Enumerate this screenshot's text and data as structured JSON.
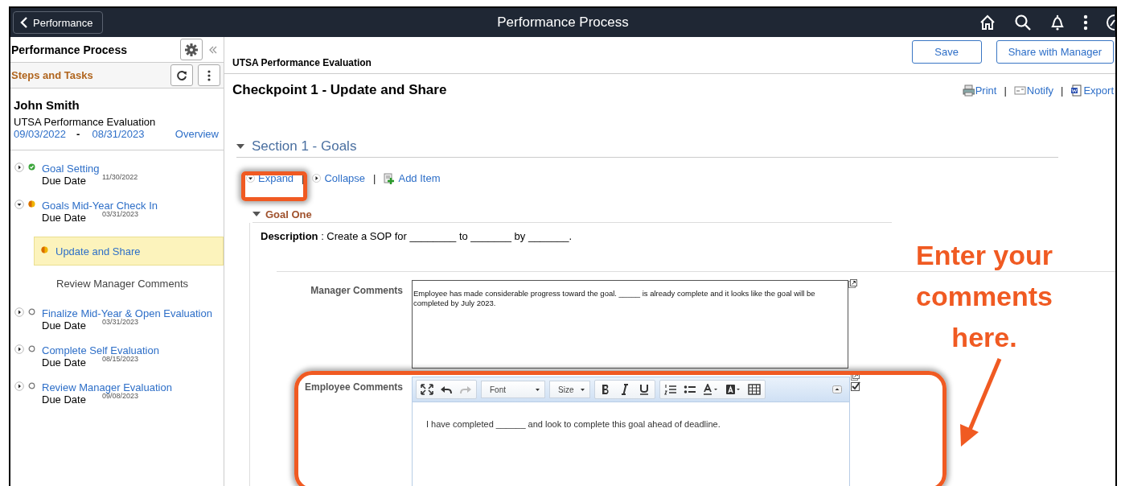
{
  "header": {
    "back_button": "Performance",
    "title": "Performance Process"
  },
  "sidebar": {
    "title": "Performance Process",
    "subtitle": "Steps and Tasks",
    "person": {
      "name": "John Smith",
      "document": "UTSA Performance Evaluation",
      "start_date": "09/03/2022",
      "separator": "-",
      "end_date": "08/31/2023",
      "overview_link": "Overview"
    },
    "steps": [
      {
        "label": "Goal Setting",
        "kind": "complete",
        "expanded": false,
        "due_label": "Due Date",
        "due_date": "11/30/2022"
      },
      {
        "label": "Goals Mid-Year Check In",
        "kind": "partial",
        "expanded": true,
        "due_label": "Due Date",
        "due_date": "03/31/2023",
        "children": [
          {
            "label": "Update and Share",
            "kind": "partial",
            "selected": true
          },
          {
            "label": "Review Manager Comments",
            "selected": false
          }
        ]
      },
      {
        "label": "Finalize Mid-Year & Open Evaluation",
        "kind": "pending",
        "expanded": false,
        "due_label": "Due Date",
        "due_date": "03/31/2023"
      },
      {
        "label": "Complete Self Evaluation",
        "kind": "pending",
        "expanded": false,
        "due_label": "Due Date",
        "due_date": "08/15/2023"
      },
      {
        "label": "Review Manager Evaluation",
        "kind": "pending",
        "expanded": false,
        "due_label": "Due Date",
        "due_date": "09/08/2023"
      }
    ]
  },
  "main": {
    "buttons": [
      "Save",
      "Share with Manager"
    ],
    "document_title": "UTSA Performance Evaluation",
    "page_title": "Checkpoint 1 - Update and Share",
    "actions": [
      {
        "kind": "link",
        "label": "Print"
      },
      {
        "kind": "separator",
        "label": "|"
      },
      {
        "kind": "link",
        "label": "Notify"
      },
      {
        "kind": "separator",
        "label": "|"
      },
      {
        "kind": "link",
        "label": "Export"
      }
    ],
    "section": {
      "title": "Section 1 - Goals",
      "expanded": true,
      "links": [
        {
          "kind": "link",
          "label": "Expand"
        },
        {
          "kind": "separator",
          "label": "|"
        },
        {
          "kind": "link",
          "label": "Collapse"
        },
        {
          "kind": "separator",
          "label": "|"
        },
        {
          "kind": "link",
          "label": "Add Item"
        }
      ],
      "goal": {
        "title": "Goal One",
        "expanded": true,
        "description_label": "Description",
        "description": " : Create a SOP for ________ to _______ by _______.",
        "manager_comments_label": "Manager Comments",
        "manager_comments": "Employee has made considerable progress toward the goal. _____ is already complete and it looks like the goal will be completed by July 2023.",
        "employee_comments_label": "Employee Comments",
        "editor_font": "Font",
        "editor_size": "Size",
        "employee_comments": "I have completed ______ and look to complete this goal ahead of deadline."
      }
    }
  },
  "annotation": {
    "callout_text": "Enter your comments here."
  }
}
